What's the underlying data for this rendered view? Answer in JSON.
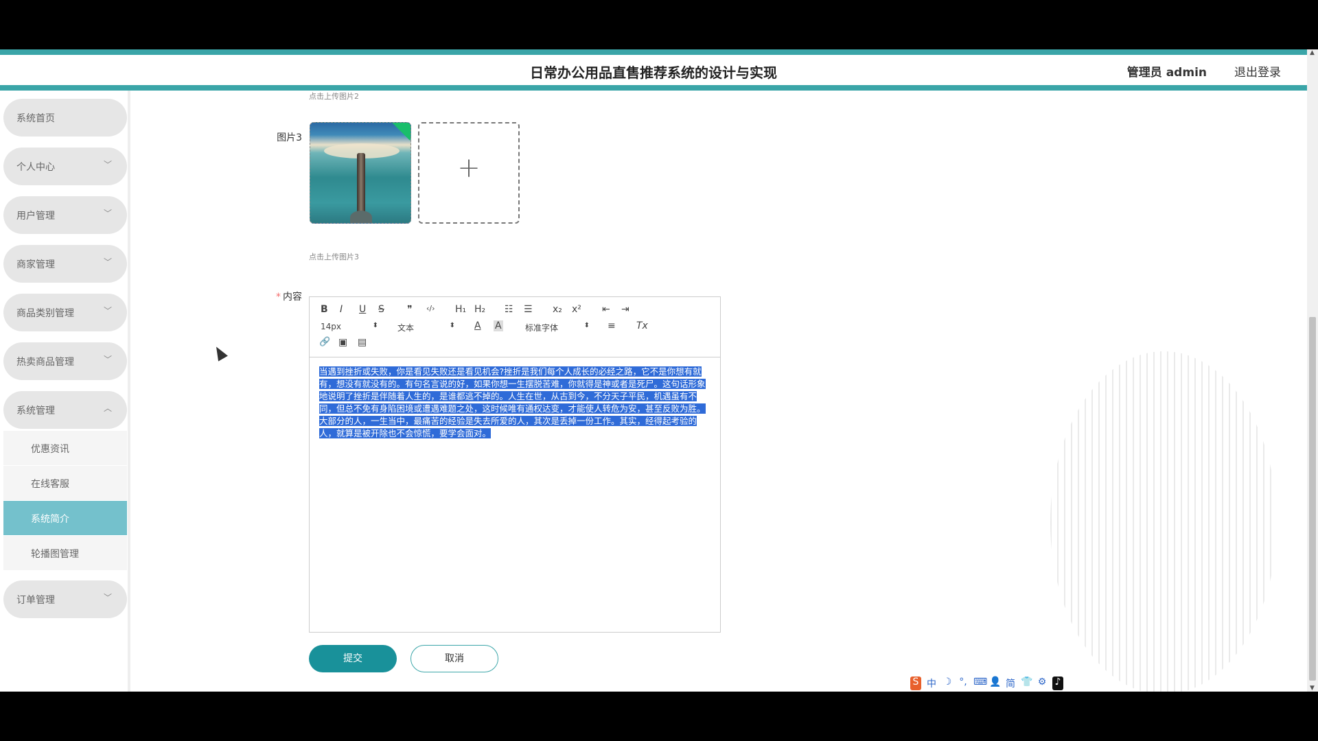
{
  "header": {
    "title": "日常办公用品直售推荐系统的设计与实现",
    "admin": "管理员 admin",
    "logout": "退出登录"
  },
  "sidebar": {
    "items": [
      {
        "label": "系统首页"
      },
      {
        "label": "个人中心"
      },
      {
        "label": "用户管理"
      },
      {
        "label": "商家管理"
      },
      {
        "label": "商品类别管理"
      },
      {
        "label": "热卖商品管理"
      },
      {
        "label": "系统管理"
      },
      {
        "label": "订单管理"
      }
    ],
    "sub_items": [
      {
        "label": "优惠资讯"
      },
      {
        "label": "在线客服"
      },
      {
        "label": "系统简介"
      },
      {
        "label": "轮播图管理"
      }
    ]
  },
  "form": {
    "hint_image2": "点击上传图片2",
    "image3_label": "图片3",
    "hint_image3": "点击上传图片3",
    "content_label": "内容",
    "required_mark": "*",
    "toolbar": {
      "bold": "B",
      "italic": "I",
      "underline": "U",
      "strike": "S",
      "quote": "❞",
      "code": "‹/›",
      "h1": "H₁",
      "h2": "H₂",
      "ordered_list": "☷",
      "bullet_list": "☰",
      "sub": "x₂",
      "sup": "x²",
      "outdent": "⇤",
      "indent": "⇥",
      "size": "14px",
      "header": "文本",
      "color": "A",
      "bg": "A",
      "font": "标准字体",
      "align": "≡",
      "clean": "Tx",
      "link": "🔗",
      "image": "▣",
      "video": "▤"
    },
    "content_text": "当遇到挫折或失败，你是看见失败还是看见机会?挫折是我们每个人成长的必经之路，它不是你想有就有，想没有就没有的。有句名言说的好，如果你想一生摆脱苦难，你就得是神或者是死尸。这句话形象地说明了挫折是伴随着人生的，是谁都逃不掉的。人生在世，从古到今，不分天子平民，机遇虽有不同，但总不免有身陷困境或遭遇难题之处，这时候唯有通权达变，才能使人转危为安，甚至反败为胜。大部分的人，一生当中，最痛苦的经验是失去所爱的人，其次是丢掉一份工作。其实，经得起考验的人，就算是被开除也不会惊慌，要学会面对。",
    "submit": "提交",
    "cancel": "取消"
  },
  "ime": [
    "S",
    "中",
    "☽",
    "°,",
    "⌨",
    "👤",
    "简",
    "👕",
    "⚙",
    "♪"
  ]
}
